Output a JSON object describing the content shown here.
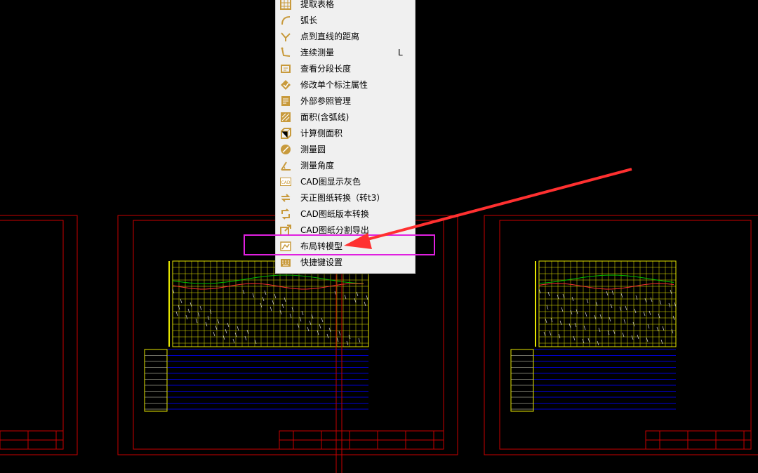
{
  "menu": {
    "items": [
      {
        "label": "提取表格",
        "icon": "table-extract-icon"
      },
      {
        "label": "弧长",
        "icon": "arc-length-icon"
      },
      {
        "label": "点到直线的距离",
        "icon": "point-line-distance-icon"
      },
      {
        "label": "连续测量",
        "icon": "continuous-measure-icon",
        "shortcut": "L"
      },
      {
        "label": "查看分段长度",
        "icon": "segment-length-icon"
      },
      {
        "label": "修改单个标注属性",
        "icon": "edit-dimension-icon"
      },
      {
        "label": "外部参照管理",
        "icon": "xref-manager-icon"
      },
      {
        "label": "面积(含弧线)",
        "icon": "area-arc-icon"
      },
      {
        "label": "计算侧面积",
        "icon": "side-area-icon"
      },
      {
        "label": "测量圆",
        "icon": "measure-circle-icon"
      },
      {
        "label": "测量角度",
        "icon": "measure-angle-icon"
      },
      {
        "label": "CAD图显示灰色",
        "icon": "gray-display-icon",
        "badge": "CAD"
      },
      {
        "label": "天正图纸转换（转t3）",
        "icon": "tangent-convert-icon"
      },
      {
        "label": "CAD图纸版本转换",
        "icon": "version-convert-icon"
      },
      {
        "label": "CAD图纸分割导出",
        "icon": "split-export-icon"
      },
      {
        "label": "布局转模型",
        "icon": "layout-to-model-icon",
        "highlighted": true
      },
      {
        "label": "快捷键设置",
        "icon": "shortcut-settings-icon"
      }
    ]
  },
  "colors": {
    "highlight_box": "#e020e0",
    "arrow": "#ff3030",
    "frame": "#c80000",
    "grid": "#e6e600",
    "table": "#0000d0",
    "icon": "#c89a3c"
  }
}
